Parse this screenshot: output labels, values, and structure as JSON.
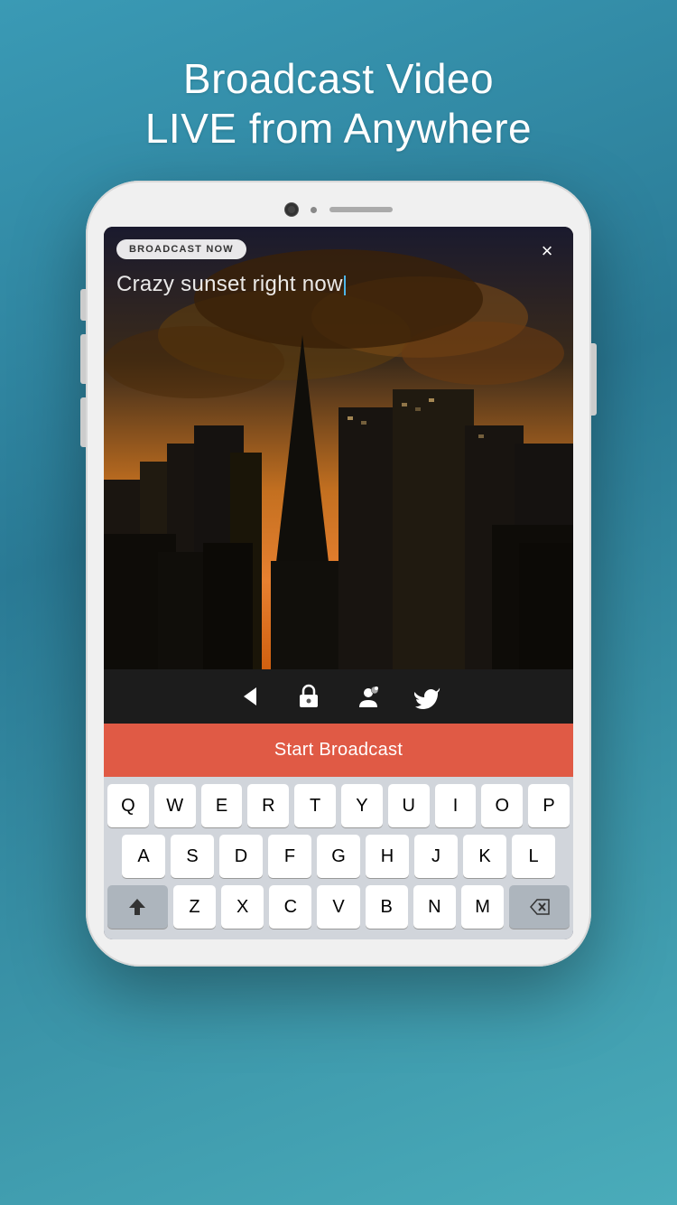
{
  "header": {
    "line1": "Broadcast Video",
    "line2": "LIVE from Anywhere"
  },
  "phone": {
    "badge": "BROADCAST NOW",
    "close_icon": "×",
    "broadcast_title": "Crazy sunset right now",
    "start_broadcast_label": "Start Broadcast"
  },
  "controls": {
    "back_icon": "◀",
    "lock_icon": "🔒",
    "person_icon": "👤",
    "twitter_icon": "🐦"
  },
  "keyboard": {
    "row1": [
      "Q",
      "W",
      "E",
      "R",
      "T",
      "Y",
      "U",
      "I",
      "O",
      "P"
    ],
    "row2": [
      "A",
      "S",
      "D",
      "F",
      "G",
      "H",
      "J",
      "K",
      "L"
    ],
    "row3": [
      "Z",
      "X",
      "C",
      "V",
      "B",
      "N",
      "M"
    ]
  }
}
